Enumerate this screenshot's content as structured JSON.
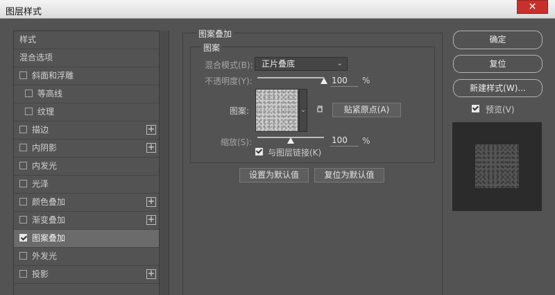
{
  "window": {
    "title": "图层样式",
    "close_glyph": "✕"
  },
  "styles_list": {
    "items": [
      {
        "label": "样式",
        "has_checkbox": false,
        "checked": false,
        "indent": 0,
        "has_plus": false
      },
      {
        "label": "混合选项",
        "has_checkbox": false,
        "checked": false,
        "indent": 0,
        "has_plus": false
      },
      {
        "label": "斜面和浮雕",
        "has_checkbox": true,
        "checked": false,
        "indent": 0,
        "has_plus": false
      },
      {
        "label": "等高线",
        "has_checkbox": true,
        "checked": false,
        "indent": 1,
        "has_plus": false
      },
      {
        "label": "纹理",
        "has_checkbox": true,
        "checked": false,
        "indent": 1,
        "has_plus": false
      },
      {
        "label": "描边",
        "has_checkbox": true,
        "checked": false,
        "indent": 0,
        "has_plus": true
      },
      {
        "label": "内阴影",
        "has_checkbox": true,
        "checked": false,
        "indent": 0,
        "has_plus": true
      },
      {
        "label": "内发光",
        "has_checkbox": true,
        "checked": false,
        "indent": 0,
        "has_plus": false
      },
      {
        "label": "光泽",
        "has_checkbox": true,
        "checked": false,
        "indent": 0,
        "has_plus": false
      },
      {
        "label": "颜色叠加",
        "has_checkbox": true,
        "checked": false,
        "indent": 0,
        "has_plus": true
      },
      {
        "label": "渐变叠加",
        "has_checkbox": true,
        "checked": false,
        "indent": 0,
        "has_plus": true
      },
      {
        "label": "图案叠加",
        "has_checkbox": true,
        "checked": true,
        "indent": 0,
        "has_plus": false,
        "selected": true
      },
      {
        "label": "外发光",
        "has_checkbox": true,
        "checked": false,
        "indent": 0,
        "has_plus": false
      },
      {
        "label": "投影",
        "has_checkbox": true,
        "checked": false,
        "indent": 0,
        "has_plus": true
      }
    ],
    "plus_glyph": "+"
  },
  "pattern_overlay": {
    "section_title": "图案叠加",
    "group_title": "图案",
    "blend_mode_label": "混合模式(B):",
    "blend_mode_value": "正片叠底",
    "opacity_label": "不透明度(Y):",
    "opacity_value": "100",
    "opacity_fraction": 1.0,
    "percent_sign": "%",
    "pattern_label": "图案:",
    "snap_origin_button": "贴紧原点(A)",
    "scale_label": "缩放(S):",
    "scale_value": "100",
    "scale_fraction": 0.5,
    "link_checkbox_label": "与图层链接(K)",
    "link_checked": true,
    "make_default_button": "设置为默认值",
    "reset_default_button": "复位为默认值",
    "dropdown_glyph": "⌄"
  },
  "right_panel": {
    "ok_button": "确定",
    "reset_button": "复位",
    "new_style_button": "新建样式(W)...",
    "preview_label": "预览(V)",
    "preview_checked": true
  }
}
